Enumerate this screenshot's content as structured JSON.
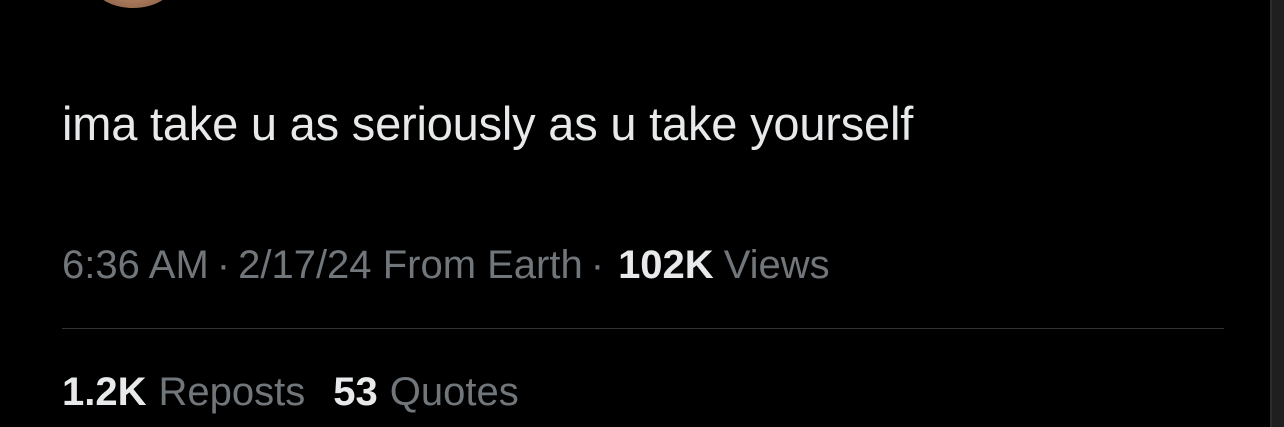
{
  "tweet": {
    "text": "ima take u as seriously as u take yourself",
    "time": "6:36 AM",
    "date": "2/17/24",
    "source": "From Earth",
    "separator": "·",
    "views_count": "102K",
    "views_label": "Views"
  },
  "stats": {
    "reposts_count": "1.2K",
    "reposts_label": "Reposts",
    "quotes_count": "53",
    "quotes_label": "Quotes"
  },
  "colors": {
    "background": "#000000",
    "primary_text": "#e7e9ea",
    "secondary_text": "#71767b",
    "divider": "#2f3336"
  }
}
